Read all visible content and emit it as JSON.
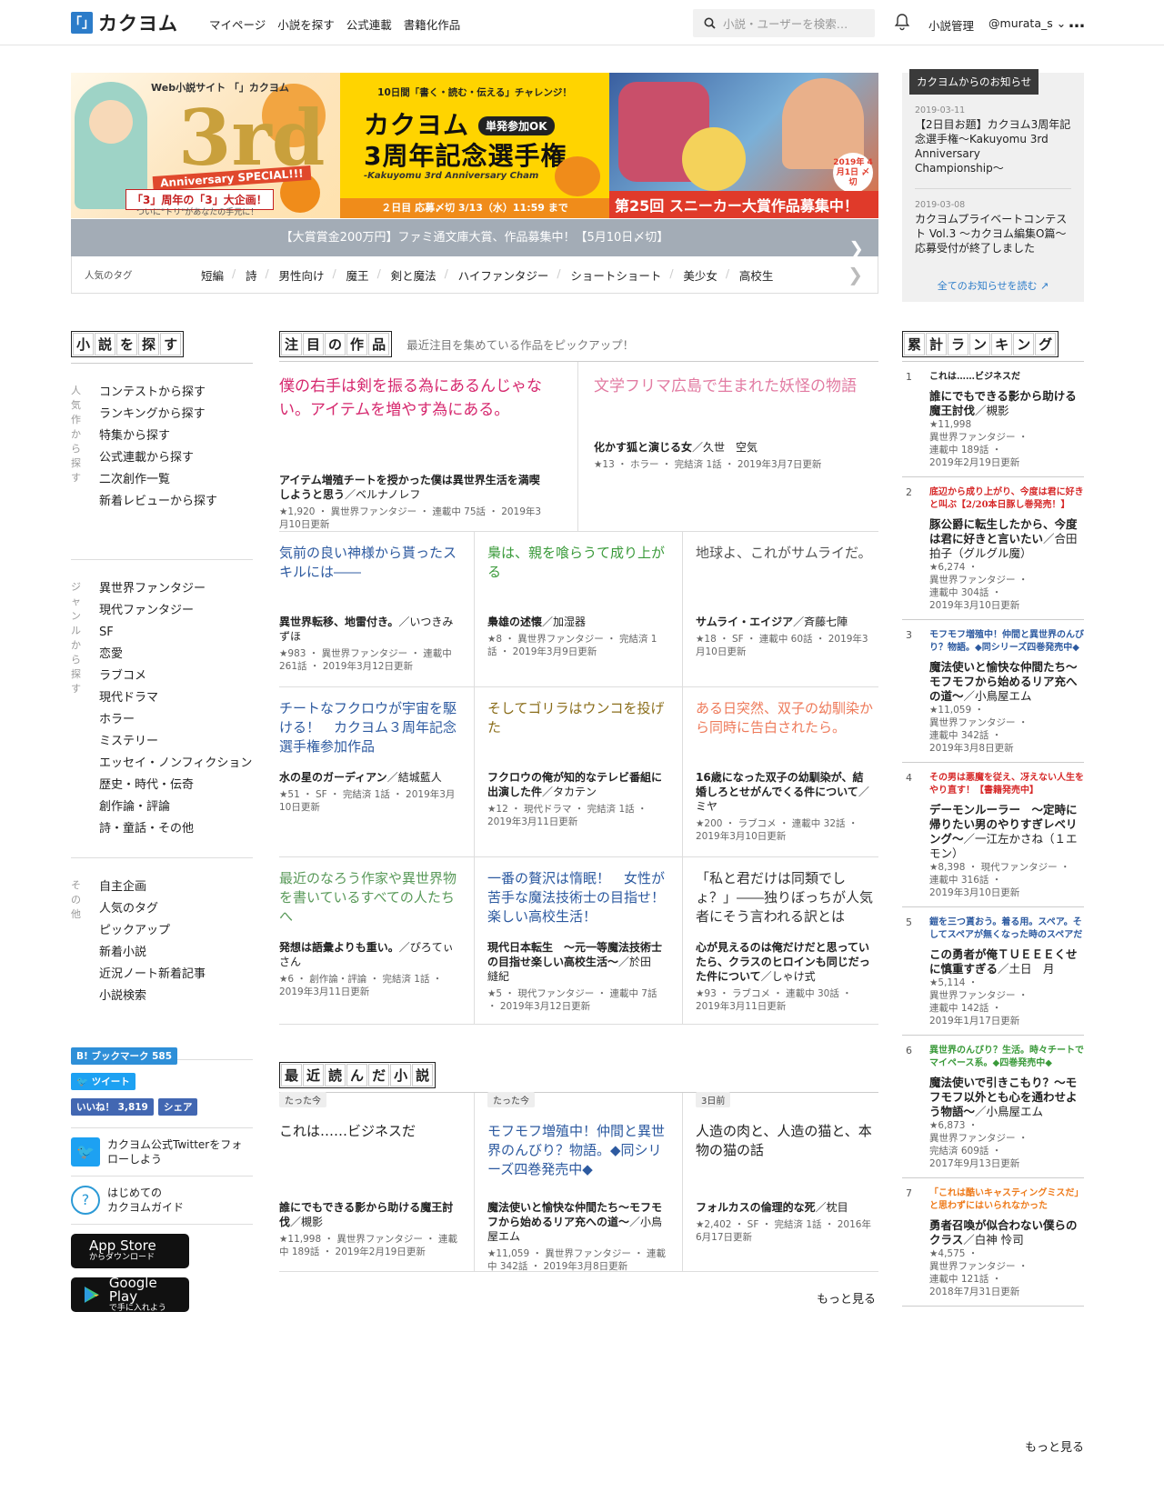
{
  "header": {
    "logo_mark": "「」",
    "logo_text": "カクヨム",
    "nav": [
      "マイページ",
      "小説を探す",
      "公式連載",
      "書籍化作品"
    ],
    "search_placeholder": "小説・ユーザーを検索…",
    "right": [
      "小説管理",
      "@murata_s ⌄"
    ],
    "more": "…"
  },
  "banners": {
    "b1": {
      "brand": "Web小説サイト 「」カクヨム",
      "big": "3rd",
      "badge": "Anniversary SPECIAL!!!",
      "sub": "「3」周年の「3」大企画！",
      "sub2": "ついに\"トリ\"があなたの手元に！"
    },
    "b2": {
      "top": "10日間「書く・読む・伝える」チャレンジ！",
      "title1": "カクヨム",
      "ok": "単発参加OK",
      "title2": "3周年記念選手権",
      "en": "-Kakuyomu 3rd Anniversary Cham",
      "deadline": "２日目 応募〆切 3/13（水）11:59 まで"
    },
    "b3": {
      "stamp": "2019年 4月1日 〆切",
      "footer": "第25回 スニーカー大賞作品募集中！"
    }
  },
  "promo": "【大賞賞金200万円】ファミ通文庫大賞、作品募集中！【5月10日〆切】",
  "tags": {
    "label": "人気のタグ",
    "items": [
      "短編",
      "詩",
      "男性向け",
      "魔王",
      "剣と魔法",
      "ハイファンタジー",
      "ショートショート",
      "美少女",
      "高校生"
    ]
  },
  "notice": {
    "head": "カクヨムからのお知らせ",
    "items": [
      {
        "date": "2019-03-11",
        "title": "【2日目お題】カクヨム3周年記念選手権〜Kakuyomu 3rd Anniversary Championship〜"
      },
      {
        "date": "2019-03-08",
        "title": "カクヨムプライベートコンテスト Vol.3 〜カクヨム編集O篇〜　応募受付が終了しました"
      }
    ],
    "all": "全てのお知らせを読む"
  },
  "left": {
    "title": [
      "小",
      "説",
      "を",
      "探",
      "す"
    ],
    "sections": [
      {
        "label": "人気作から探す",
        "items": [
          "コンテストから探す",
          "ランキングから探す",
          "特集から探す",
          "公式連載から探す",
          "二次創作一覧",
          "新着レビューから探す"
        ]
      },
      {
        "label": "ジャンルから探す",
        "items": [
          "異世界ファンタジー",
          "現代ファンタジー",
          "SF",
          "恋愛",
          "ラブコメ",
          "現代ドラマ",
          "ホラー",
          "ミステリー",
          "エッセイ・ノンフィクション",
          "歴史・時代・伝奇",
          "創作論・評論",
          "詩・童話・その他"
        ]
      },
      {
        "label": "その他",
        "items": [
          "自主企画",
          "人気のタグ",
          "ピックアップ",
          "新着小説",
          "近況ノート新着記事",
          "小説検索"
        ]
      }
    ],
    "bookmark": "B! ブックマーク 585",
    "tweet": "ツイート",
    "like": "いいね！ 3,819",
    "share": "シェア",
    "twitter": "カクヨム公式Twitterをフォローしよう",
    "guide": "はじめての\nカクヨムガイド",
    "appstore": {
      "name": "App Store",
      "sub": "からダウンロード"
    },
    "googleplay": {
      "name": "Google Play",
      "sub": "で手に入れよう"
    }
  },
  "featured": {
    "title": [
      "注",
      "目",
      "の",
      "作",
      "品"
    ],
    "desc": "最近注目を集めている作品をピックアップ！",
    "items": [
      {
        "catch": "僕の右手は剣を振る為にあるんじゃない。アイテムを増やす為にある。",
        "color": "#d6286e",
        "work": "アイテム増殖チートを授かった僕は異世界生活を満喫しようと思う",
        "author": "／ベルナノレフ",
        "meta": "★1,920 ・ 異世界ファンタジー ・ 連載中 75話 ・ 2019年3月10日更新"
      },
      {
        "catch": "文学フリマ広島で生まれた妖怪の物語",
        "color": "#e27ba2",
        "work": "化かす狐と演じる女",
        "author": "／久世　空気",
        "meta": "★13 ・ ホラー ・ 完結済 1話 ・ 2019年3月7日更新"
      },
      {
        "catch": "気前の良い神様から貰ったスキルには――",
        "color": "#2d5aa0",
        "work": "異世界転移、地雷付き。",
        "author": "／いつきみずほ",
        "meta": "★983 ・ 異世界ファンタジー ・ 連載中 261話 ・ 2019年3月12日更新"
      },
      {
        "catch": "梟は、親を喰らうて成り上がる",
        "color": "#3a9a3a",
        "work": "梟雄の述懐",
        "author": "／加湿器",
        "meta": "★8 ・ 異世界ファンタジー ・ 完結済 1話 ・ 2019年3月9日更新"
      },
      {
        "catch": "地球よ、これがサムライだ。",
        "color": "#555",
        "work": "サムライ・エイジア",
        "author": "／斉藤七陣",
        "meta": "★18 ・ SF ・ 連載中 60話 ・ 2019年3月10日更新"
      },
      {
        "catch": "チートなフクロウが宇宙を駆ける！　カクヨム３周年記念選手権参加作品",
        "color": "#2d5aa0",
        "work": "水の星のガーディアン",
        "author": "／結城藍人",
        "meta": "★51 ・ SF ・ 完結済 1話 ・ 2019年3月10日更新"
      },
      {
        "catch": "そしてゴリラはウンコを投げた",
        "color": "#8a6d1a",
        "work": "フクロウの俺が知的なテレビ番組に出演した件",
        "author": "／タカテン",
        "meta": "★12 ・ 現代ドラマ ・ 完結済 1話 ・ 2019年3月11日更新"
      },
      {
        "catch": "ある日突然、双子の幼馴染から同時に告白されたら。",
        "color": "#ee7a5a",
        "work": "16歳になった双子の幼馴染が、結婚しろとせがんでくる件について",
        "author": "／ミヤ",
        "meta": "★200 ・ ラブコメ ・ 連載中 32話 ・ 2019年3月10日更新"
      },
      {
        "catch": "最近のなろう作家や異世界物を書いているすべての人たちへ",
        "color": "#5a9a5a",
        "work": "発想は語彙よりも重い。",
        "author": "／ぴろてぃさん",
        "meta": "★6 ・ 創作論・評論 ・ 完結済 1話 ・ 2019年3月11日更新"
      },
      {
        "catch": "一番の贅沢は惰眠！　女性が苦手な魔法技術士の目指せ！　楽しい高校生活！",
        "color": "#2d5aa0",
        "work": "現代日本転生　〜元一等魔法技術士の目指せ楽しい高校生活〜",
        "author": "／於田　縫紀",
        "meta": "★5 ・ 現代ファンタジー ・ 連載中 7話 ・ 2019年3月12日更新"
      },
      {
        "catch": "「私と君だけは同類でしょ？」――独りぼっちが人気者にそう言われる訳とは",
        "color": "#333",
        "work": "心が見えるのは俺だけだと思っていたら、クラスのヒロインも同じだった件について",
        "author": "／しゃけ式",
        "meta": "★93 ・ ラブコメ ・ 連載中 30話 ・ 2019年3月11日更新"
      }
    ]
  },
  "recent": {
    "title": [
      "最",
      "近",
      "読",
      "ん",
      "だ",
      "小",
      "説"
    ],
    "items": [
      {
        "tag": "たった今",
        "catch": "これは……ビジネスだ",
        "color": "#222",
        "work": "誰にでもできる影から助ける魔王討伐",
        "author": "／槻影",
        "meta": "★11,998 ・ 異世界ファンタジー ・ 連載中 189話 ・ 2019年2月19日更新"
      },
      {
        "tag": "たった今",
        "catch": "モフモフ増殖中！仲間と異世界のんびり？物語。◆同シリーズ四巻発売中◆",
        "color": "#2d5aa0",
        "work": "魔法使いと愉快な仲間たち～モフモフから始めるリア充への道～",
        "author": "／小鳥屋エム",
        "meta": "★11,059 ・ 異世界ファンタジー ・ 連載中 342話 ・ 2019年3月8日更新"
      },
      {
        "tag": "3日前",
        "catch": "人造の肉と、人造の猫と、本物の猫の話",
        "color": "#222",
        "work": "フォルカスの倫理的な死",
        "author": "／枕目",
        "meta": "★2,402 ・ SF ・ 完結済 1話 ・ 2016年6月17日更新"
      }
    ],
    "more": "もっと見る"
  },
  "ranking": {
    "title": [
      "累",
      "計",
      "ラ",
      "ン",
      "キ",
      "ン",
      "グ"
    ],
    "items": [
      {
        "no": "1",
        "catch": "これは……ビジネスだ",
        "color": "#222",
        "work": "誰にでもできる影から助ける魔王討伐",
        "author": "／槻影",
        "meta": [
          "★11,998",
          "異世界ファンタジー ・",
          "連載中 189話 ・",
          "2019年2月19日更新"
        ]
      },
      {
        "no": "2",
        "catch": "底辺から成り上がり、今度は君に好きと叫ぶ【2/20本日豚し巻発売！】",
        "color": "#d62828",
        "work": "豚公爵に転生したから、今度は君に好きと言いたい",
        "author": "／合田拍子（グルグル魔）",
        "meta": [
          "★6,274 ・",
          "異世界ファンタジー ・",
          "連載中 304話 ・",
          "2019年3月10日更新"
        ]
      },
      {
        "no": "3",
        "catch": "モフモフ増殖中！仲間と異世界のんびり？物語。◆同シリーズ四巻発売中◆",
        "color": "#2d5aa0",
        "work": "魔法使いと愉快な仲間たち～モフモフから始めるリア充への道～",
        "author": "／小鳥屋エム",
        "meta": [
          "★11,059 ・",
          "異世界ファンタジー ・",
          "連載中 342話 ・",
          "2019年3月8日更新"
        ]
      },
      {
        "no": "4",
        "catch": "その男は悪魔を従え、冴えない人生をやり直す！【書籍発売中】",
        "color": "#d62828",
        "work": "デーモンルーラー　〜定時に帰りたい男のやりすぎレベリング〜",
        "author": "／一江左かさね（１エモン）",
        "meta": [
          "★8,398 ・ 現代ファンタジー ・",
          "連載中 316話 ・",
          "2019年3月10日更新"
        ]
      },
      {
        "no": "5",
        "catch": "鎧を三つ貰おう。着る用。スペア。そしてスペアが無くなった時のスペアだ",
        "color": "#2d5aa0",
        "work": "この勇者が俺ＴＵＥＥＥくせに慎重すぎる",
        "author": "／土日　月",
        "meta": [
          "★5,114 ・",
          "異世界ファンタジー ・",
          "連載中 142話 ・",
          "2019年1月17日更新"
        ]
      },
      {
        "no": "6",
        "catch": "異世界のんびり？生活。時々チートでマイペース系。◆四巻発売中◆",
        "color": "#3a9a3a",
        "work": "魔法使いで引きこもり？～モフモフ以外とも心を通わせよう物語～",
        "author": "／小鳥屋エム",
        "meta": [
          "★6,873 ・",
          "異世界ファンタジー ・",
          "完結済 609話 ・",
          "2017年9月13日更新"
        ]
      },
      {
        "no": "7",
        "catch": "「これは酷いキャスティングミスだ」と思わずにはいられなかった",
        "color": "#ee7a1a",
        "work": "勇者召喚が似合わない僕らのクラス",
        "author": "／白神 怜司",
        "meta": [
          "★4,575 ・",
          "異世界ファンタジー ・",
          "連載中 121話 ・",
          "2018年7月31日更新"
        ]
      }
    ],
    "more": "もっと見る"
  }
}
